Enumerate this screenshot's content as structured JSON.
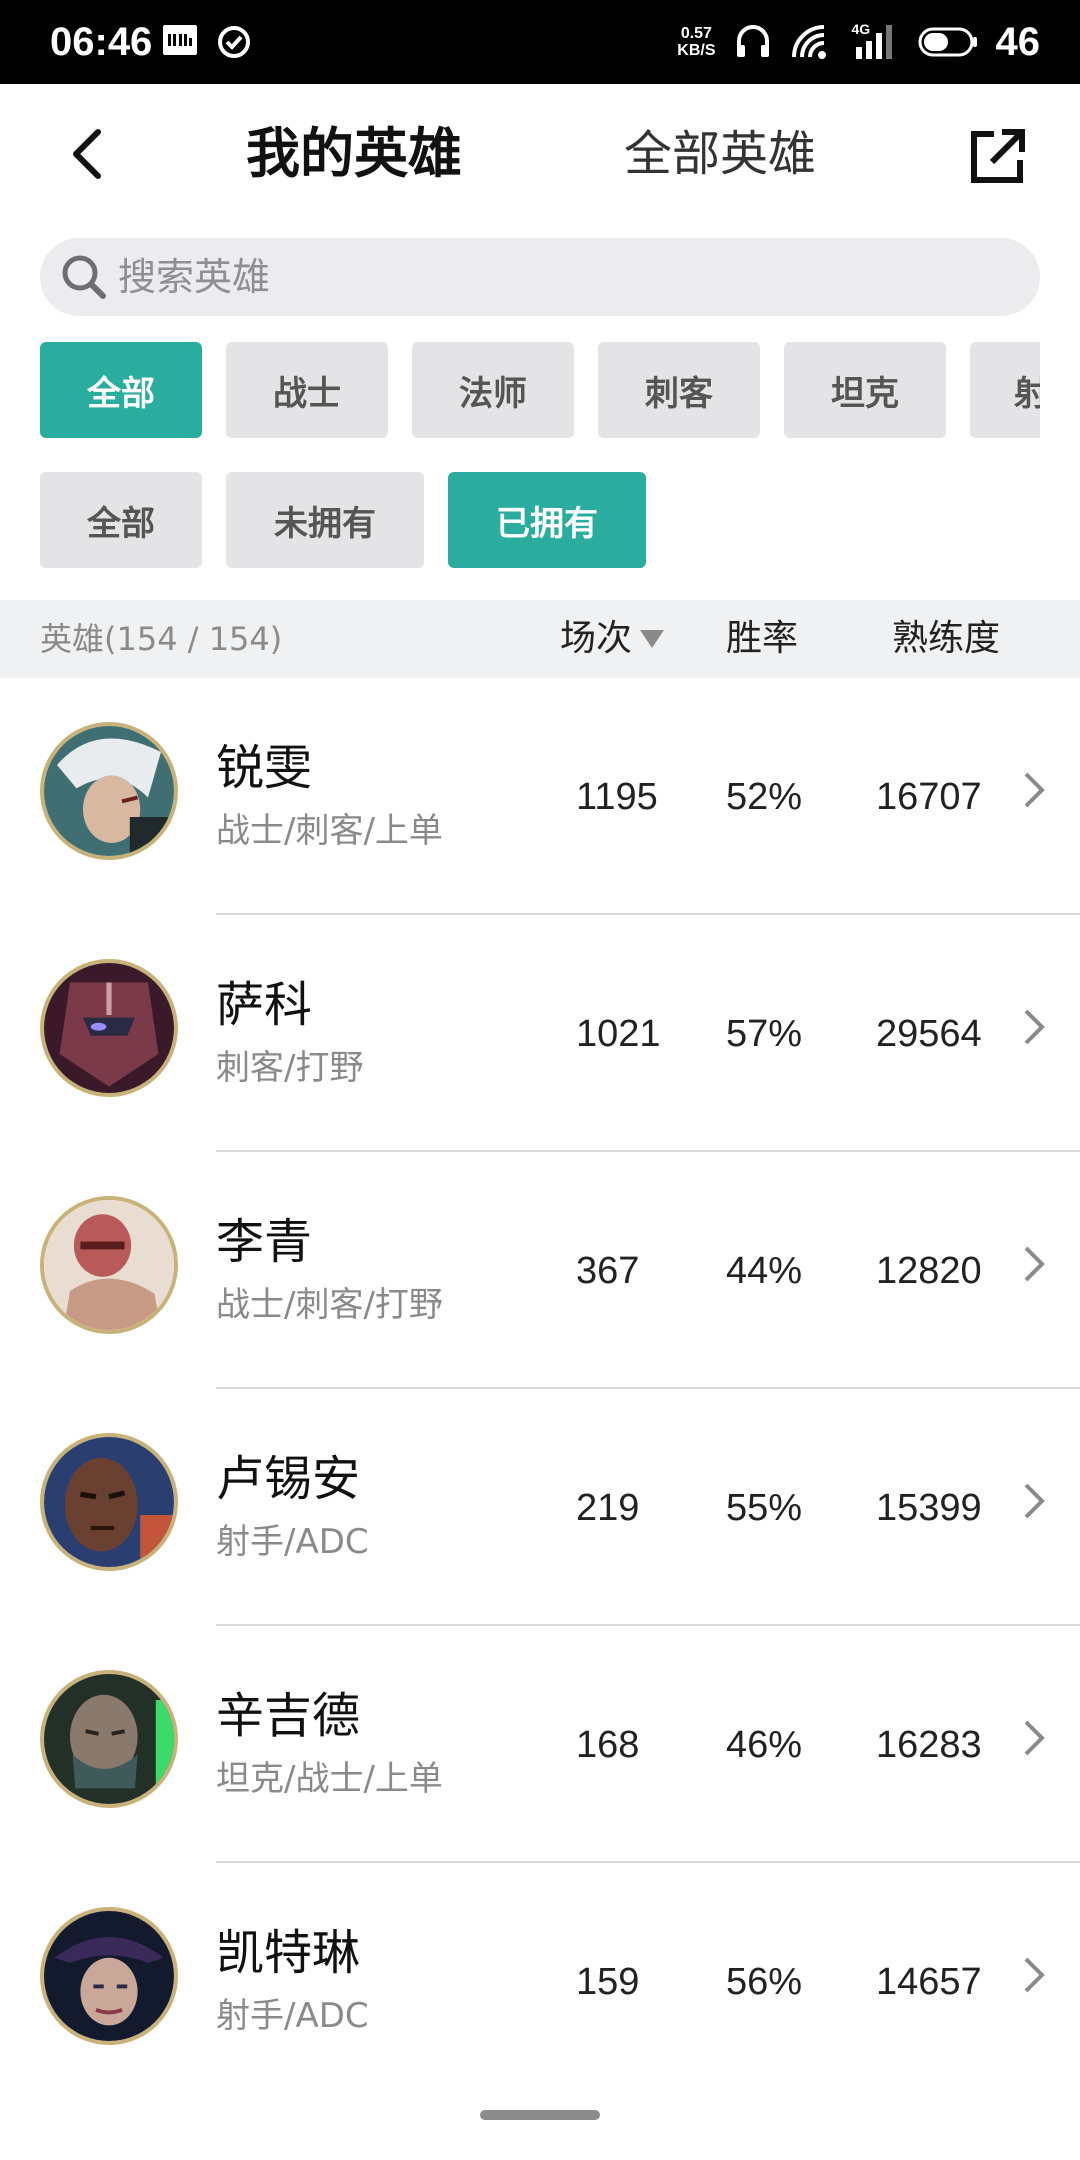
{
  "status_bar": {
    "time": "06:46",
    "net_speed_value": "0.57",
    "net_speed_unit": "KB/S",
    "network": "4G",
    "battery": "46"
  },
  "header": {
    "title_mine": "我的英雄",
    "title_all": "全部英雄"
  },
  "search": {
    "placeholder": "搜索英雄"
  },
  "filters": {
    "roles": [
      "全部",
      "战士",
      "法师",
      "刺客",
      "坦克",
      "射手"
    ],
    "roles_active": "全部",
    "ownership": [
      "全部",
      "未拥有",
      "已拥有"
    ],
    "ownership_active": "已拥有"
  },
  "list_header": {
    "count_label": "英雄(154 / 154)",
    "matches": "场次",
    "winrate": "胜率",
    "mastery": "熟练度"
  },
  "colors": {
    "accent": "#2aac9e",
    "avatar_ring": "#c9b27a"
  },
  "heroes": [
    {
      "name": "锐雯",
      "roles": "战士/刺客/上单",
      "matches": "1195",
      "winrate": "52%",
      "mastery": "16707"
    },
    {
      "name": "萨科",
      "roles": "刺客/打野",
      "matches": "1021",
      "winrate": "57%",
      "mastery": "29564"
    },
    {
      "name": "李青",
      "roles": "战士/刺客/打野",
      "matches": "367",
      "winrate": "44%",
      "mastery": "12820"
    },
    {
      "name": "卢锡安",
      "roles": "射手/ADC",
      "matches": "219",
      "winrate": "55%",
      "mastery": "15399"
    },
    {
      "name": "辛吉德",
      "roles": "坦克/战士/上单",
      "matches": "168",
      "winrate": "46%",
      "mastery": "16283"
    },
    {
      "name": "凯特琳",
      "roles": "射手/ADC",
      "matches": "159",
      "winrate": "56%",
      "mastery": "14657"
    }
  ]
}
